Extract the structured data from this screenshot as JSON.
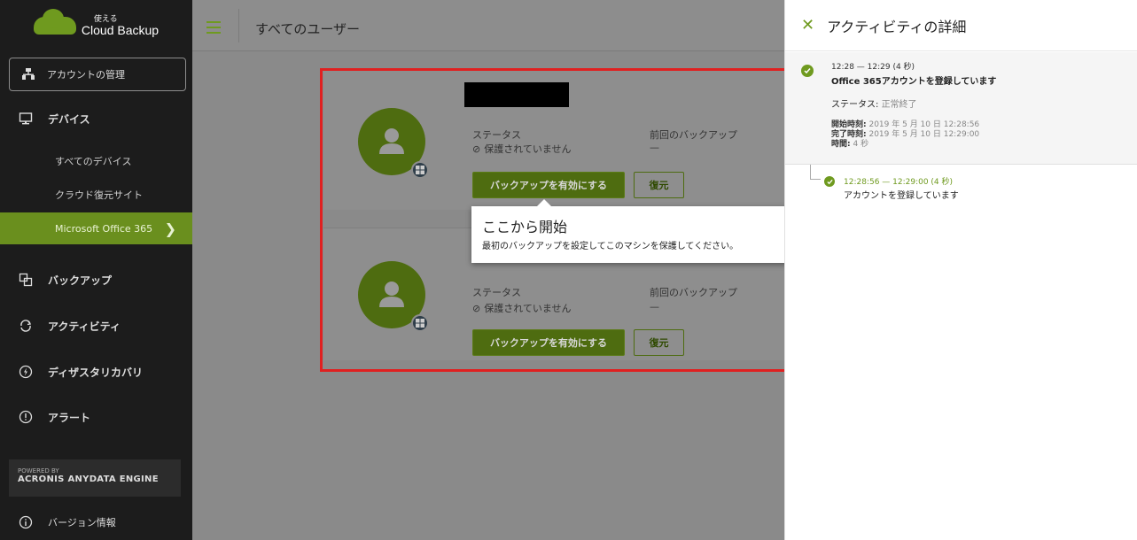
{
  "brand": {
    "small": "使える",
    "big": "Cloud Backup"
  },
  "colors": {
    "accent": "#6f9a1f",
    "highlight": "#e02020",
    "sidebar": "#1c1c1c"
  },
  "sidebar": {
    "account_button": "アカウントの管理",
    "devices": "デバイス",
    "sub_items": [
      "すべてのデバイス",
      "クラウド復元サイト",
      "Microsoft Office 365"
    ],
    "items": [
      "バックアップ",
      "アクティビティ",
      "ディザスタリカバリ",
      "アラート"
    ],
    "powered_small": "POWERED BY",
    "powered_big": "ACRONIS ANYDATA ENGINE",
    "version": "バージョン情報"
  },
  "header": {
    "title": "すべてのユーザー"
  },
  "cards": [
    {
      "status_label": "ステータス",
      "status_value": "保護されていません",
      "last_backup_label": "前回のバックアップ",
      "last_backup_value": "—",
      "enable_button": "バックアップを有効にする",
      "restore_button": "復元"
    },
    {
      "status_label": "ステータス",
      "status_value": "保護されていません",
      "last_backup_label": "前回のバックアップ",
      "last_backup_value": "—",
      "enable_button": "バックアップを有効にする",
      "restore_button": "復元"
    }
  ],
  "tooltip": {
    "title": "ここから開始",
    "body": "最初のバックアップを設定してこのマシンを保護してください。"
  },
  "panel": {
    "title": "アクティビティの詳細",
    "activity": {
      "time": "12:28 — 12:29 (4 秒)",
      "title": "Office 365アカウントを登録しています",
      "status_label": "ステータス:",
      "status_value": "正常終了",
      "start_label": "開始時刻:",
      "start_value": "2019 年 5 月 10 日 12:28:56",
      "end_label": "完了時刻:",
      "end_value": "2019 年 5 月 10 日 12:29:00",
      "duration_label": "時間:",
      "duration_value": "4 秒"
    },
    "sub_activity": {
      "time": "12:28:56 — 12:29:00 (4 秒)",
      "title": "アカウントを登録しています"
    }
  }
}
